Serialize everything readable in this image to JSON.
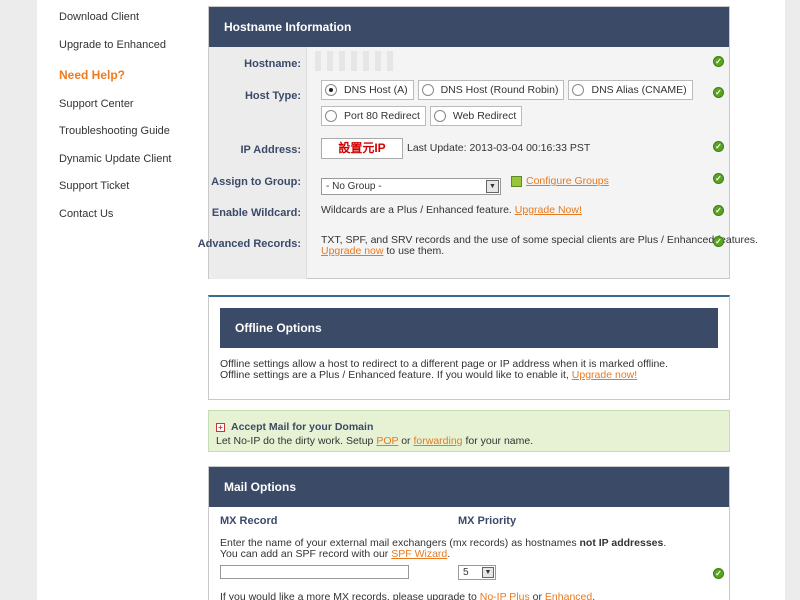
{
  "sidebar": {
    "items": [
      "Download Client",
      "Upgrade to Enhanced"
    ],
    "help_heading": "Need Help?",
    "help_items": [
      "Support Center",
      "Troubleshooting Guide",
      "Dynamic Update Client",
      "Support Ticket",
      "Contact Us"
    ]
  },
  "hostinfo": {
    "title": "Hostname Information",
    "hostname_label": "Hostname:",
    "hosttype_label": "Host Type:",
    "host_types": [
      "DNS Host (A)",
      "DNS Host (Round Robin)",
      "DNS Alias (CNAME)",
      "Port 80 Redirect",
      "Web Redirect"
    ],
    "selected_host_type": "DNS Host (A)",
    "ip_label": "IP Address:",
    "ip_value": "設置元IP",
    "last_update": "Last Update: 2013-03-04 00:16:33 PST",
    "group_label": "Assign to Group:",
    "group_value": "- No Group -",
    "configure_groups": "Configure Groups",
    "wildcard_label": "Enable Wildcard:",
    "wildcard_text": "Wildcards are a Plus / Enhanced feature.",
    "wildcard_link": "Upgrade Now!",
    "advanced_label": "Advanced Records:",
    "advanced_text1": "TXT, SPF, and SRV records and the use of some special clients are Plus / Enhanced features.",
    "advanced_link": "Upgrade now",
    "advanced_text2": "to use them."
  },
  "offline": {
    "title": "Offline Options",
    "line1": "Offline settings allow a host to redirect to a different page or IP address when it is marked offline.",
    "line2": "Offline settings are a Plus / Enhanced feature. If you would like to enable it,",
    "link": "Upgrade now!"
  },
  "mail_accept": {
    "title": "Accept Mail for your Domain",
    "text1": "Let No-IP do the dirty work. Setup",
    "link_pop": "POP",
    "text_or": "or",
    "link_forwarding": "forwarding",
    "text2": "for your name."
  },
  "mail_options": {
    "title": "Mail Options",
    "col_mx_record": "MX Record",
    "col_mx_priority": "MX Priority",
    "desc1": "Enter the name of your external mail exchangers (mx records) as hostnames",
    "desc1_bold": "not IP addresses",
    "desc1_end": ".",
    "desc2": "You can add an SPF record with our",
    "spf_link": "SPF Wizard",
    "desc2_end": ".",
    "mx_input_value": "",
    "mx_priority_value": "5",
    "foot_text": "If you would like a more MX records, please upgrade to",
    "foot_link1": "No-IP Plus",
    "foot_or": "or",
    "foot_link2": "Enhanced",
    "foot_end": "."
  },
  "icons": {
    "ok": "check-circle-icon",
    "edit": "edit-icon",
    "plus": "plus-box-icon"
  },
  "colors": {
    "panel_header": "#3b4a67",
    "link": "#e8791f",
    "help": "#f07b1f",
    "ok": "#5aa51f",
    "accept_bg": "#e6f2d3"
  }
}
